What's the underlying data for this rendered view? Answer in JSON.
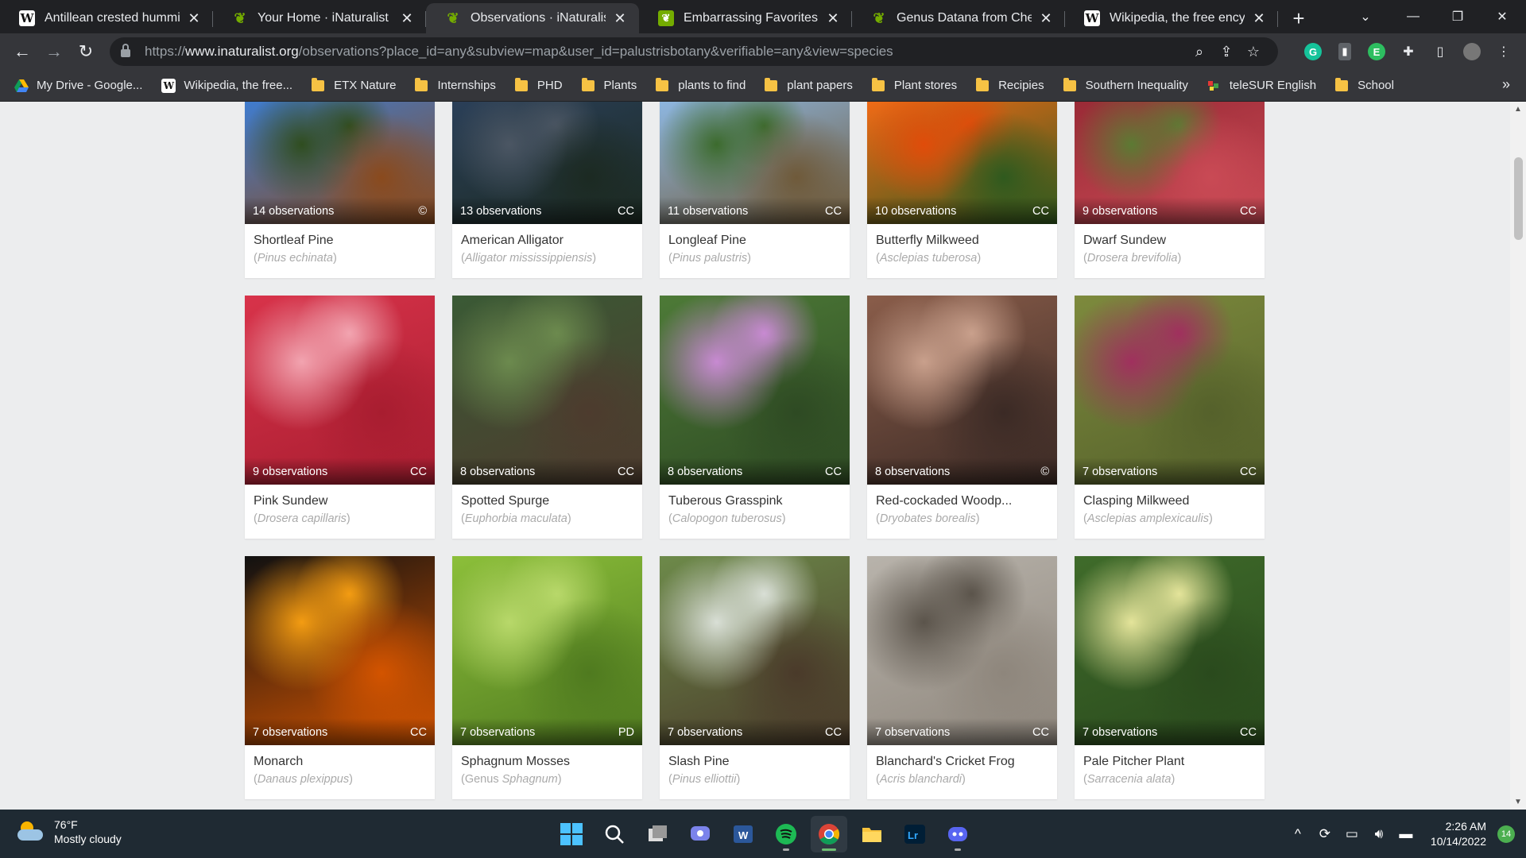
{
  "browser": {
    "tabs": [
      {
        "title": "Antillean crested humming",
        "favicon": "wikipedia-icon",
        "active": false
      },
      {
        "title": "Your Home · iNaturalist",
        "favicon": "inaturalist-icon",
        "active": false
      },
      {
        "title": "Observations · iNaturalist",
        "favicon": "inaturalist-icon",
        "active": true
      },
      {
        "title": "Embarrassing Favorites - N",
        "favicon": "inaturalist-box-icon",
        "active": false
      },
      {
        "title": "Genus Datana from Cherok",
        "favicon": "inaturalist-icon",
        "active": false
      },
      {
        "title": "Wikipedia, the free encyclo",
        "favicon": "wikipedia-icon",
        "active": false
      }
    ],
    "new_tab_label": "+",
    "url_scheme": "https://",
    "url_host": "www.inaturalist.org",
    "url_path": "/observations?place_id=any&subview=map&user_id=palustrisbotany&verifiable=any&view=species",
    "bookmarks": [
      {
        "label": "My Drive - Google...",
        "icon": "google-drive-icon"
      },
      {
        "label": "Wikipedia, the free...",
        "icon": "wikipedia-icon"
      },
      {
        "label": "ETX Nature",
        "icon": "folder-icon"
      },
      {
        "label": "Internships",
        "icon": "folder-icon"
      },
      {
        "label": "PHD",
        "icon": "folder-icon"
      },
      {
        "label": "Plants",
        "icon": "folder-icon"
      },
      {
        "label": "plants to find",
        "icon": "folder-icon"
      },
      {
        "label": "plant papers",
        "icon": "folder-icon"
      },
      {
        "label": "Plant stores",
        "icon": "folder-icon"
      },
      {
        "label": "Recipies",
        "icon": "folder-icon"
      },
      {
        "label": "Southern Inequality",
        "icon": "folder-icon"
      },
      {
        "label": "teleSUR English",
        "icon": "telesur-icon"
      },
      {
        "label": "School",
        "icon": "folder-icon"
      }
    ],
    "bookmarks_more": "»"
  },
  "species": [
    {
      "common": "Shortleaf Pine",
      "scientific": "Pinus echinata",
      "prefix": "",
      "count": "14 observations",
      "license": "©",
      "colors": [
        "#3f7ccf",
        "#2f4d1f",
        "#8a4a1d"
      ]
    },
    {
      "common": "American Alligator",
      "scientific": "Alligator mississippiensis",
      "prefix": "",
      "count": "13 observations",
      "license": "CC",
      "colors": [
        "#2a3f58",
        "#4b5663",
        "#1c2a22"
      ]
    },
    {
      "common": "Longleaf Pine",
      "scientific": "Pinus palustris",
      "prefix": "",
      "count": "11 observations",
      "license": "CC",
      "colors": [
        "#8db6e0",
        "#3c6b2d",
        "#6f5a3a"
      ]
    },
    {
      "common": "Butterfly Milkweed",
      "scientific": "Asclepias tuberosa",
      "prefix": "",
      "count": "10 observations",
      "license": "CC",
      "colors": [
        "#f06a16",
        "#e04c0a",
        "#2f5a1e"
      ]
    },
    {
      "common": "Dwarf Sundew",
      "scientific": "Drosera brevifolia",
      "prefix": "",
      "count": "9 observations",
      "license": "CC",
      "colors": [
        "#9a2a36",
        "#5c7a33",
        "#c94a55"
      ]
    },
    {
      "common": "Pink Sundew",
      "scientific": "Drosera capillaris",
      "prefix": "",
      "count": "9 observations",
      "license": "CC",
      "colors": [
        "#d8334a",
        "#f2a4b0",
        "#a81d30"
      ]
    },
    {
      "common": "Spotted Spurge",
      "scientific": "Euphorbia maculata",
      "prefix": "",
      "count": "8 observations",
      "license": "CC",
      "colors": [
        "#3a5a35",
        "#6c8a4e",
        "#4d3b2e"
      ]
    },
    {
      "common": "Tuberous Grasspink",
      "scientific": "Calopogon tuberosus",
      "prefix": "",
      "count": "8 observations",
      "license": "CC",
      "colors": [
        "#4d7a37",
        "#c88ad2",
        "#2e4a23"
      ]
    },
    {
      "common": "Red-cockaded Woodp...",
      "scientific": "Dryobates borealis",
      "prefix": "",
      "count": "8 observations",
      "license": "©",
      "colors": [
        "#8a5d4a",
        "#c9a08c",
        "#3b2a25"
      ]
    },
    {
      "common": "Clasping Milkweed",
      "scientific": "Asclepias amplexicaulis",
      "prefix": "",
      "count": "7 observations",
      "license": "CC",
      "colors": [
        "#7d8a3d",
        "#a0305e",
        "#55612b"
      ]
    },
    {
      "common": "Monarch",
      "scientific": "Danaus plexippus",
      "prefix": "",
      "count": "7 observations",
      "license": "CC",
      "colors": [
        "#111111",
        "#f39c12",
        "#d35400"
      ]
    },
    {
      "common": "Sphagnum Mosses",
      "scientific": "Sphagnum",
      "prefix": "Genus ",
      "count": "7 observations",
      "license": "PD",
      "colors": [
        "#8cbf3a",
        "#b8d86a",
        "#4f7a1f"
      ]
    },
    {
      "common": "Slash Pine",
      "scientific": "Pinus elliottii",
      "prefix": "",
      "count": "7 observations",
      "license": "CC",
      "colors": [
        "#6d8a4a",
        "#d9dfd6",
        "#4a3a2a"
      ]
    },
    {
      "common": "Blanchard's Cricket Frog",
      "scientific": "Acris blanchardi",
      "prefix": "",
      "count": "7 observations",
      "license": "CC",
      "colors": [
        "#b8b3ab",
        "#5b544b",
        "#8e867c"
      ]
    },
    {
      "common": "Pale Pitcher Plant",
      "scientific": "Sarracenia alata",
      "prefix": "",
      "count": "7 observations",
      "license": "CC",
      "colors": [
        "#3f6b2a",
        "#e4e49a",
        "#2a4a1d"
      ]
    }
  ],
  "taskbar": {
    "temperature": "76°F",
    "weather": "Mostly cloudy",
    "time": "2:26 AM",
    "date": "10/14/2022",
    "notifications": "14"
  }
}
